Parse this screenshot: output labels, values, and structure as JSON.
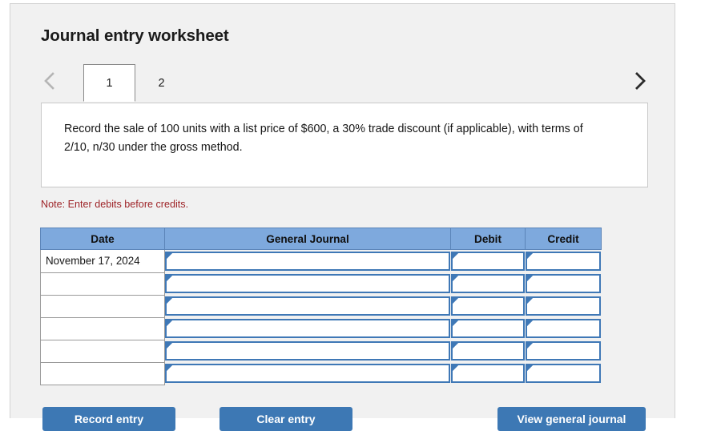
{
  "worksheet": {
    "title": "Journal entry worksheet",
    "note": "Note: Enter debits before credits."
  },
  "tabs": {
    "prev_icon": "chevron-left-icon",
    "next_icon": "chevron-right-icon",
    "items": [
      {
        "label": "1",
        "active": true
      },
      {
        "label": "2",
        "active": false
      }
    ]
  },
  "instruction": {
    "text": "Record the sale of 100 units with a list price of $600, a 30% trade discount (if applicable), with terms of 2/10, n/30 under the gross method."
  },
  "table": {
    "headers": {
      "date": "Date",
      "general_journal": "General Journal",
      "debit": "Debit",
      "credit": "Credit"
    },
    "rows": [
      {
        "date": "November 17, 2024",
        "general_journal": "",
        "debit": "",
        "credit": ""
      },
      {
        "date": "",
        "general_journal": "",
        "debit": "",
        "credit": ""
      },
      {
        "date": "",
        "general_journal": "",
        "debit": "",
        "credit": ""
      },
      {
        "date": "",
        "general_journal": "",
        "debit": "",
        "credit": ""
      },
      {
        "date": "",
        "general_journal": "",
        "debit": "",
        "credit": ""
      },
      {
        "date": "",
        "general_journal": "",
        "debit": "",
        "credit": ""
      }
    ]
  },
  "buttons": {
    "record": "Record entry",
    "clear": "Clear entry",
    "view": "View general journal"
  },
  "colors": {
    "header_blue": "#7ea9dd",
    "button_blue": "#3d78b4",
    "input_border_blue": "#3f78b6",
    "note_red": "#9e2327",
    "panel_gray": "#f1f1f1"
  }
}
